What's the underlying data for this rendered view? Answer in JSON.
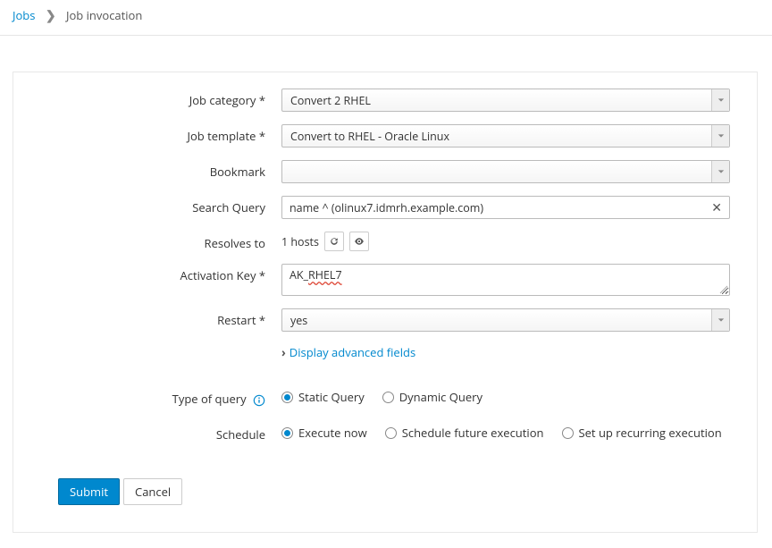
{
  "breadcrumb": {
    "root": "Jobs",
    "current": "Job invocation"
  },
  "fields": {
    "job_category": {
      "label": "Job category *",
      "value": "Convert 2 RHEL"
    },
    "job_template": {
      "label": "Job template *",
      "value": "Convert to RHEL - Oracle Linux"
    },
    "bookmark": {
      "label": "Bookmark",
      "value": ""
    },
    "search_query": {
      "label": "Search Query",
      "value": "name ^ (olinux7.idmrh.example.com)"
    },
    "resolves_to": {
      "label": "Resolves to",
      "value": "1 hosts"
    },
    "activation_key": {
      "label": "Activation Key *",
      "value_prefix": "AK_",
      "value_suffix": "RHEL7"
    },
    "restart": {
      "label": "Restart *",
      "value": "yes"
    }
  },
  "advanced_toggle": "Display advanced fields",
  "type_of_query": {
    "label": "Type of query",
    "options": [
      "Static Query",
      "Dynamic Query"
    ],
    "selected": 0
  },
  "schedule": {
    "label": "Schedule",
    "options": [
      "Execute now",
      "Schedule future execution",
      "Set up recurring execution"
    ],
    "selected": 0
  },
  "buttons": {
    "submit": "Submit",
    "cancel": "Cancel"
  }
}
